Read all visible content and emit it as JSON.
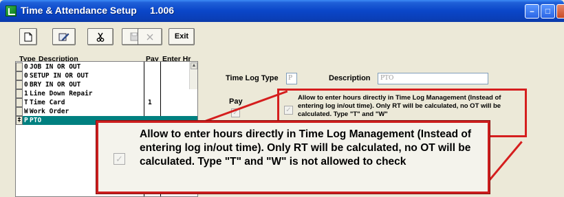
{
  "window": {
    "title": "Time & Attendance Setup",
    "version": "1.006",
    "controls": {
      "minimize": "–",
      "maximize": "□",
      "close": "×"
    }
  },
  "toolbar": {
    "new_icon": "new-document-icon",
    "edit_icon": "edit-icon",
    "cut_icon": "scissors-icon",
    "save_icon": "save-icon",
    "delete_icon": "delete-icon",
    "exit_label": "Exit"
  },
  "list": {
    "headers": {
      "type": "Type",
      "description": "Description",
      "pay": "Pay",
      "enter": "Enter Hr"
    },
    "rows": [
      {
        "type": "0",
        "description": "JOB IN OR OUT",
        "pay": ""
      },
      {
        "type": "0",
        "description": "SETUP IN OR OUT",
        "pay": ""
      },
      {
        "type": "0",
        "description": "BRY IN OR OUT",
        "pay": ""
      },
      {
        "type": "1",
        "description": "Line Down Repair",
        "pay": ""
      },
      {
        "type": "T",
        "description": "Time Card",
        "pay": "1"
      },
      {
        "type": "W",
        "description": "Work Order",
        "pay": ""
      },
      {
        "type": "P",
        "description": "PTO",
        "pay": "",
        "selected": true
      }
    ],
    "current_marker": "‡"
  },
  "detail": {
    "time_log_type_label": "Time Log Type",
    "time_log_type_value": "P",
    "description_label": "Description",
    "description_value": "PTO",
    "pay_label": "Pay",
    "pay_checked": true,
    "enter_hours_checked": true,
    "enter_hours_text": "Allow to enter hours directly in Time Log Management (Instead of entering log in/out time).  Only RT will be calculated, no OT will be calculated.  Type \"T\" and \"W\""
  },
  "callout": {
    "checked": true,
    "text": "Allow to enter hours directly in Time Log Management (Instead of entering log in/out time).  Only RT will be calculated, no OT will be calculated.  Type \"T\" and \"W\" is not allowed to check"
  },
  "colors": {
    "titlebar": "#0a46c8",
    "selection": "#008080",
    "highlight_red": "#d51e1e"
  }
}
